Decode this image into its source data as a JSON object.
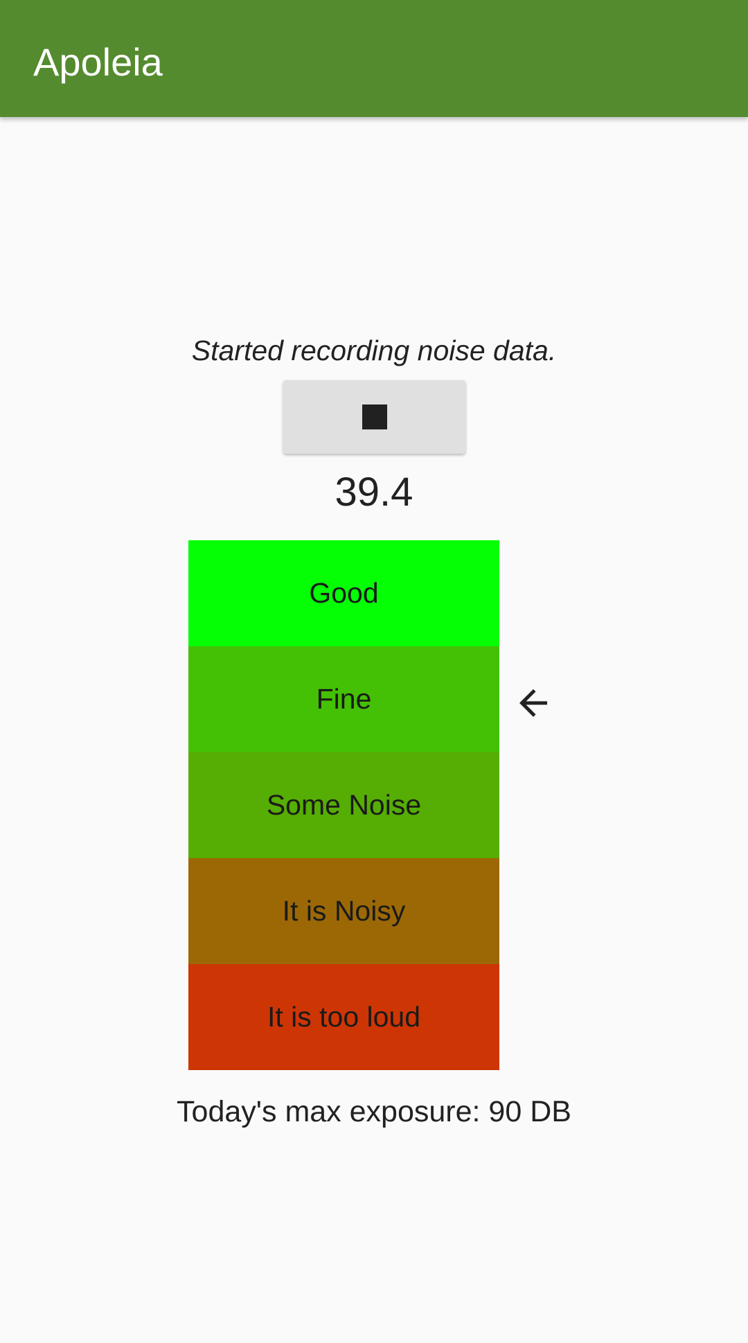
{
  "app_bar": {
    "title": "Apoleia",
    "color": "#558b2f"
  },
  "status": {
    "message": "Started recording noise data."
  },
  "controls": {
    "stop_icon": "stop-icon"
  },
  "reading": {
    "value": "39.4",
    "current_level": "Fine",
    "indicator_icon": "arrow-left-icon"
  },
  "levels": [
    {
      "label": "Good",
      "color": "#05ff05"
    },
    {
      "label": "Fine",
      "color": "#44c005"
    },
    {
      "label": "Some Noise",
      "color": "#56ad03"
    },
    {
      "label": "It is Noisy",
      "color": "#9c6805"
    },
    {
      "label": "It is too loud",
      "color": "#ce3505"
    }
  ],
  "summary": {
    "max_exposure": "Today's max exposure: 90 DB"
  }
}
